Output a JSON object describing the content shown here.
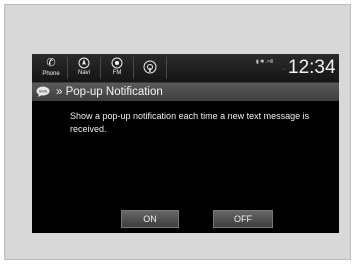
{
  "app_bar": {
    "phone_label": "Phone",
    "navi_label": "Navi",
    "fm_label": "FM",
    "clock": "12:34",
    "status_top": "▮ ✱ ↗ill",
    "status_bottom": "↔"
  },
  "header": {
    "title": "Pop-up Notification",
    "breadcrumb_glyph": "»",
    "sms_badge": "SMS"
  },
  "main": {
    "message": "Show a pop-up notification each time a new text message is received."
  },
  "buttons": {
    "on_label": "ON",
    "off_label": "OFF"
  },
  "colors": {
    "screen_bg": "#000000",
    "frame_bg": "#d8d8d8",
    "button_bg": "#555555"
  },
  "icons": {
    "phone": "phone-icon",
    "navi": "navi-icon",
    "fm": "radio-icon",
    "audio": "audio-source-icon",
    "sms": "sms-icon"
  }
}
